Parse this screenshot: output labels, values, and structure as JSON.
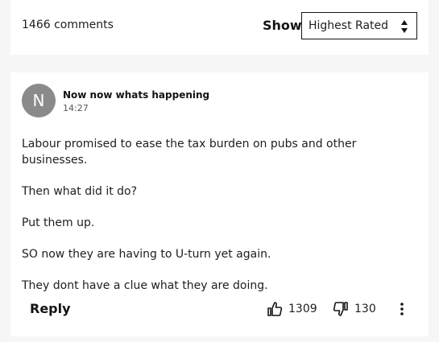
{
  "header": {
    "comments_count": "1466 comments",
    "show_label": "Show",
    "sort": {
      "selected": "Highest Rated"
    }
  },
  "comment": {
    "avatar_initial": "N",
    "author": "Now now whats happening",
    "time": "14:27",
    "paragraphs": [
      "Labour promised to ease the tax burden on pubs and other businesses.",
      "Then what did it do?",
      "Put them up.",
      "SO now they are having to U-turn yet again.",
      "They dont have a clue what they are doing."
    ],
    "reply_label": "Reply",
    "upvotes": "1309",
    "downvotes": "130",
    "icons": {
      "upvote": "thumbs-up-icon",
      "downvote": "thumbs-down-icon",
      "more": "more-vertical-icon",
      "sort": "sort-arrows-icon"
    }
  },
  "colors": {
    "avatar_bg": "#8a8a8a",
    "page_bg": "#f6f6f6",
    "text": "#141414"
  }
}
